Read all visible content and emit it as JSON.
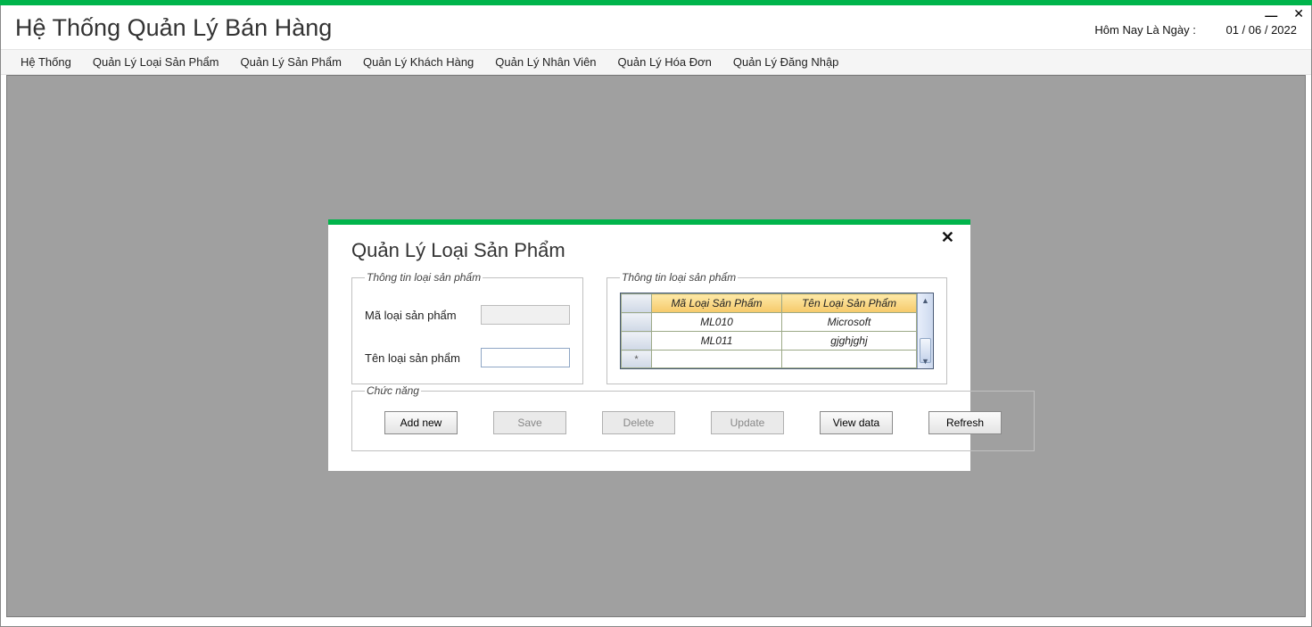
{
  "window": {
    "title": "Hệ Thống Quản Lý Bán Hàng",
    "date_label": "Hôm Nay Là Ngày :",
    "date_value": "01 / 06 / 2022",
    "minimize_glyph": "—",
    "close_glyph": "✕"
  },
  "menu": {
    "items": [
      "Hệ Thống",
      "Quản Lý Loại Sản Phẩm",
      "Quản Lý Sản Phẩm",
      "Quản Lý Khách Hàng",
      "Quản Lý Nhân Viên",
      "Quản Lý Hóa Đơn",
      "Quản Lý Đăng Nhập"
    ]
  },
  "child": {
    "title": "Quản Lý Loại Sản Phẩm",
    "close_glyph": "✕",
    "group_info_left": "Thông tin loại sản phẩm",
    "group_info_right": "Thông tin loại sản phẩm",
    "group_func": "Chức năng",
    "form": {
      "code_label": "Mã loại sản phẩm",
      "code_value": "",
      "name_label": "Tên loại sản phẩm",
      "name_value": ""
    },
    "grid": {
      "col1": "Mã Loại Sản Phẩm",
      "col2": "Tên Loại Sản Phẩm",
      "rows": [
        {
          "c1": "ML010",
          "c2": "Microsoft"
        },
        {
          "c1": "ML011",
          "c2": "gjghjghj"
        }
      ],
      "newrow_marker": "*"
    },
    "buttons": {
      "addnew": "Add new",
      "save": "Save",
      "delete": "Delete",
      "update": "Update",
      "viewdata": "View data",
      "refresh": "Refresh"
    }
  }
}
